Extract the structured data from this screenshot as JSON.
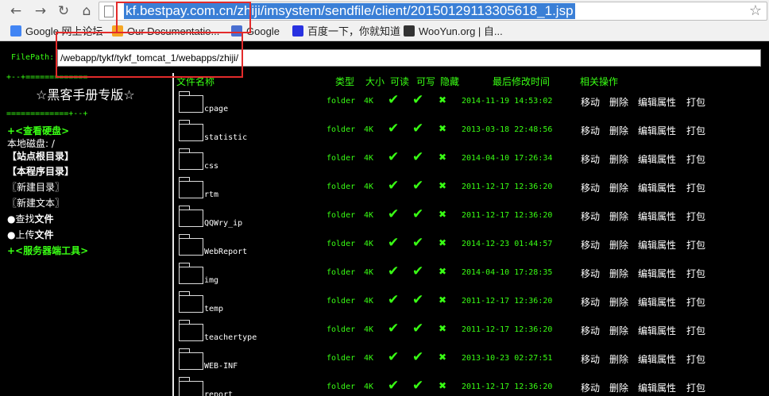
{
  "browser": {
    "url": "kf.bestpay.com.cn/zhiji/imsystem/sendfile/client/20150129113305618_1.jsp",
    "nav": {
      "back": "←",
      "forward": "→",
      "reload": "↻",
      "home": "⌂"
    },
    "star": "☆"
  },
  "bookmarks": [
    {
      "label": "Google 网上论坛",
      "icon_color": "#4285f4"
    },
    {
      "label": "Our Documentatio...",
      "icon_color": "#f5a623"
    },
    {
      "label": "Google",
      "icon_color": "#4a6fd1"
    },
    {
      "label": "百度一下，你就知道",
      "icon_color": "#2932e1"
    },
    {
      "label": "WooYun.org | 自...",
      "icon_color": "#333333"
    }
  ],
  "filepath": {
    "label": "FilePath:",
    "value": "/webapp/tykf/tykf_tomcat_1/webapps/zhiji/"
  },
  "sidebar": {
    "border_top": "+--+=============",
    "title": "☆黑客手册专版☆",
    "border_mid": "=============+--+",
    "view_disk": "+<查看硬盘>",
    "local_disk": "本地磁盘: /",
    "site_root": "【站点根目录】",
    "prog_dir": "【本程序目录】",
    "new_dir": "〖新建目录〗",
    "new_text": "〖新建文本〗",
    "find_prefix": "●查找",
    "find_file": "文件",
    "upload_prefix": "●上传",
    "upload_file": "文件",
    "server_tools": "+<服务器端工具>"
  },
  "table": {
    "headers": {
      "name": "文件名称",
      "type": "类型",
      "size": "大小",
      "readable": "可读",
      "writable": "可写",
      "hidden": "隐藏",
      "modified": "最后修改时间",
      "actions": "相关操作"
    },
    "check": "✔",
    "cross": "✖",
    "actions": {
      "move": "移动",
      "delete": "删除",
      "edit": "编辑属性",
      "pack": "打包"
    },
    "rows": [
      {
        "name": "cpage",
        "type": "folder",
        "size": "4K",
        "modified": "2014-11-19 14:53:02"
      },
      {
        "name": "statistic",
        "type": "folder",
        "size": "4K",
        "modified": "2013-03-18 22:48:56"
      },
      {
        "name": "css",
        "type": "folder",
        "size": "4K",
        "modified": "2014-04-10 17:26:34"
      },
      {
        "name": "rtm",
        "type": "folder",
        "size": "4K",
        "modified": "2011-12-17 12:36:20"
      },
      {
        "name": "QQWry_ip",
        "type": "folder",
        "size": "4K",
        "modified": "2011-12-17 12:36:20"
      },
      {
        "name": "WebReport",
        "type": "folder",
        "size": "4K",
        "modified": "2014-12-23 01:44:57"
      },
      {
        "name": "img",
        "type": "folder",
        "size": "4K",
        "modified": "2014-04-10 17:28:35"
      },
      {
        "name": "temp",
        "type": "folder",
        "size": "4K",
        "modified": "2011-12-17 12:36:20"
      },
      {
        "name": "teachertype",
        "type": "folder",
        "size": "4K",
        "modified": "2011-12-17 12:36:20"
      },
      {
        "name": "WEB-INF",
        "type": "folder",
        "size": "4K",
        "modified": "2013-10-23 02:27:51"
      },
      {
        "name": "report",
        "type": "folder",
        "size": "4K",
        "modified": "2011-12-17 12:36:20"
      }
    ]
  },
  "colors": {
    "accent": "#39ff14",
    "annotation": "#e32b2b",
    "selection": "#3a7fd6"
  }
}
